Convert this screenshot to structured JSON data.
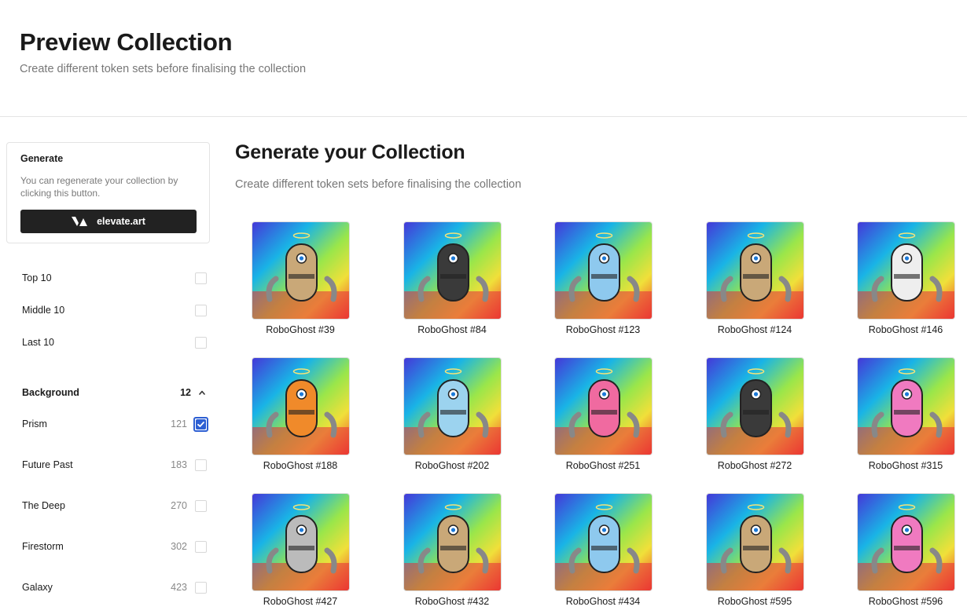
{
  "header": {
    "title": "Preview Collection",
    "subtitle": "Create different token sets before finalising the collection"
  },
  "generate_card": {
    "title": "Generate",
    "description": "You can regenerate your collection by clicking this button.",
    "button_label": "elevate.art",
    "button_icon": "elevate-logo-icon"
  },
  "quick_filters": [
    {
      "label": "Top 10",
      "checked": false
    },
    {
      "label": "Middle 10",
      "checked": false
    },
    {
      "label": "Last 10",
      "checked": false
    }
  ],
  "trait_section": {
    "title": "Background",
    "count": "12",
    "expanded": true,
    "options": [
      {
        "label": "Prism",
        "count": "121",
        "checked": true
      },
      {
        "label": "Future Past",
        "count": "183",
        "checked": false
      },
      {
        "label": "The Deep",
        "count": "270",
        "checked": false
      },
      {
        "label": "Firestorm",
        "count": "302",
        "checked": false
      },
      {
        "label": "Galaxy",
        "count": "423",
        "checked": false
      }
    ]
  },
  "main": {
    "title": "Generate your Collection",
    "subtitle": "Create different token sets before finalising the collection"
  },
  "tokens": [
    {
      "name": "RoboGhost #39"
    },
    {
      "name": "RoboGhost #84"
    },
    {
      "name": "RoboGhost #123"
    },
    {
      "name": "RoboGhost #124"
    },
    {
      "name": "RoboGhost #146"
    },
    {
      "name": "RoboGhost #188"
    },
    {
      "name": "RoboGhost #202"
    },
    {
      "name": "RoboGhost #251"
    },
    {
      "name": "RoboGhost #272"
    },
    {
      "name": "RoboGhost #315"
    },
    {
      "name": "RoboGhost #427"
    },
    {
      "name": "RoboGhost #432"
    },
    {
      "name": "RoboGhost #434"
    },
    {
      "name": "RoboGhost #595"
    },
    {
      "name": "RoboGhost #596"
    }
  ],
  "colors": {
    "accent": "#2d5fd3",
    "button_bg": "#222222",
    "token_body_colors": [
      "#c9a878",
      "#3a3a3a",
      "#8ec9ee",
      "#c9a878",
      "#eeeeee",
      "#f08a2a",
      "#9cd3ef",
      "#f06aa0",
      "#3a3a3a",
      "#f07ac0",
      "#bbbbbb",
      "#c9a878",
      "#8ec9ee",
      "#c9a878",
      "#f07ac0"
    ]
  }
}
